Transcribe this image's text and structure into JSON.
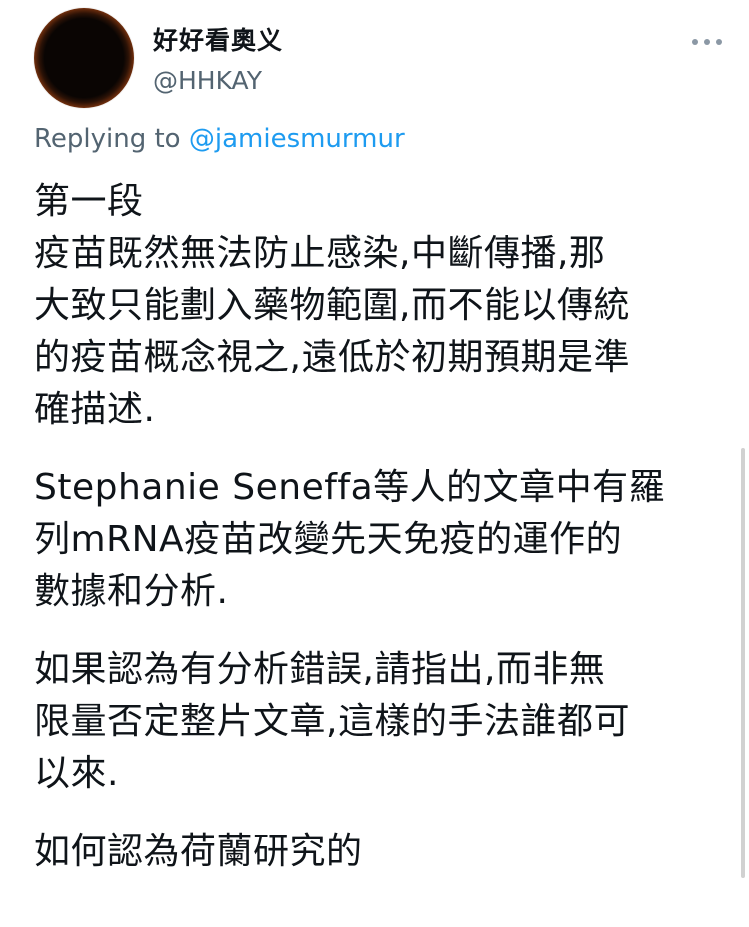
{
  "author": {
    "display_name": "好好看奧义",
    "handle": "@HHKAY",
    "avatar_icon": "avatar-image"
  },
  "more_icon": "more-horizontal-icon",
  "reply": {
    "prefix": "Replying to",
    "mention": "@jamiesmurmur"
  },
  "paragraphs": [
    "第一段\n疫苗既然無法防止感染,中斷傳播,那\n大致只能劃入藥物範圍,而不能以傳統\n的疫苗概念視之,遠低於初期預期是準\n確描述.",
    "Stephanie Seneffa等人的文章中有羅\n列mRNA疫苗改變先天免疫的運作的\n數據和分析.",
    "如果認為有分析錯誤,請指出,而非無\n限量否定整片文章,這樣的手法誰都可\n以來.",
    "如何認為荷蘭研究的"
  ],
  "colors": {
    "text": "#0f1419",
    "secondary": "#536471",
    "link": "#1d9bf0",
    "background": "#ffffff"
  }
}
